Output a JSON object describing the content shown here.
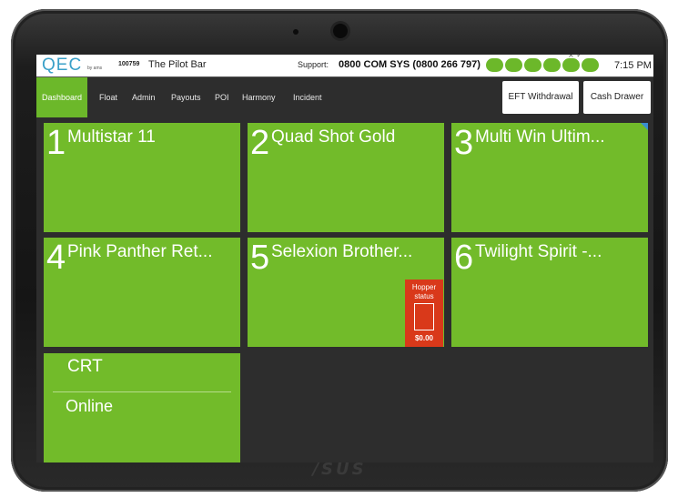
{
  "header": {
    "logo": "QEC",
    "logo_sub": "by ams",
    "site_id": "100759",
    "site_name": "The Pilot Bar",
    "support_label": "Support:",
    "support_number": "0800 COM SYS (0800 266 797)",
    "status_indicators": [
      "",
      "",
      "",
      "",
      "",
      ""
    ],
    "close_control": "× ✓",
    "time": "7:15 PM"
  },
  "nav": {
    "items": [
      "Dashboard",
      "Float",
      "Admin",
      "Payouts",
      "POI",
      "Harmony",
      "Incident"
    ],
    "active": "Dashboard",
    "eft_withdrawal": "EFT Withdrawal",
    "cash_drawer": "Cash Drawer"
  },
  "machines": [
    {
      "number": "1",
      "name": "Multistar 11"
    },
    {
      "number": "2",
      "name": "Quad Shot Gold"
    },
    {
      "number": "3",
      "name": "Multi Win Ultim..."
    },
    {
      "number": "4",
      "name": "Pink Panther Ret..."
    },
    {
      "number": "5",
      "name": "Selexion Brother..."
    },
    {
      "number": "6",
      "name": "Twilight  Spirit -..."
    }
  ],
  "hopper": {
    "label_line1": "Hopper",
    "label_line2": "status",
    "amount": "$0.00"
  },
  "crt": {
    "label": "CRT",
    "status": "Online"
  },
  "device": {
    "brand": "/SUS"
  },
  "colors": {
    "tile_green": "#72bb2a",
    "hopper_red": "#d9391a",
    "logo_blue": "#3aa0c8",
    "corner_flag": "#3a8fd0"
  }
}
